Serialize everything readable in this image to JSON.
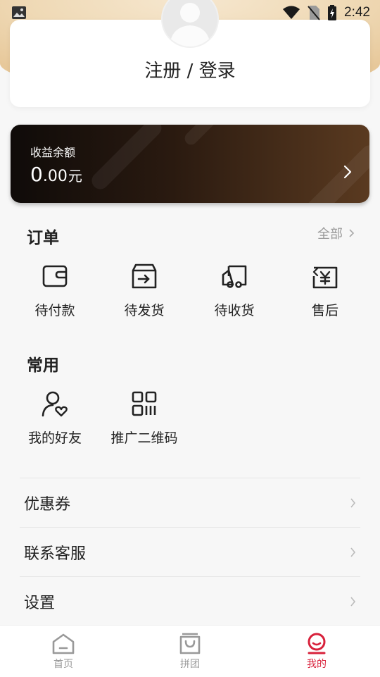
{
  "status_bar": {
    "time": "2:42"
  },
  "login": {
    "title": "注册 / 登录"
  },
  "balance": {
    "label": "收益余额",
    "amount_int": "0",
    "amount_dec": ".00",
    "unit": "元"
  },
  "orders": {
    "title": "订单",
    "all_label": "全部",
    "items": [
      {
        "label": "待付款",
        "icon": "wallet-icon"
      },
      {
        "label": "待发货",
        "icon": "box-ship-icon"
      },
      {
        "label": "待收货",
        "icon": "truck-icon"
      },
      {
        "label": "售后",
        "icon": "refund-yen-icon"
      }
    ]
  },
  "common": {
    "title": "常用",
    "items": [
      {
        "label": "我的好友",
        "icon": "friend-heart-icon"
      },
      {
        "label": "推广二维码",
        "icon": "qr-code-icon"
      }
    ]
  },
  "menu": [
    {
      "label": "优惠券"
    },
    {
      "label": "联系客服"
    },
    {
      "label": "设置"
    }
  ],
  "tabbar": [
    {
      "label": "首页",
      "icon": "home-icon",
      "active": false
    },
    {
      "label": "拼团",
      "icon": "bag-icon",
      "active": false
    },
    {
      "label": "我的",
      "icon": "profile-icon",
      "active": true
    }
  ],
  "colors": {
    "accent": "#d8213b",
    "card_dark": "#2a1a10",
    "muted": "#999999"
  }
}
